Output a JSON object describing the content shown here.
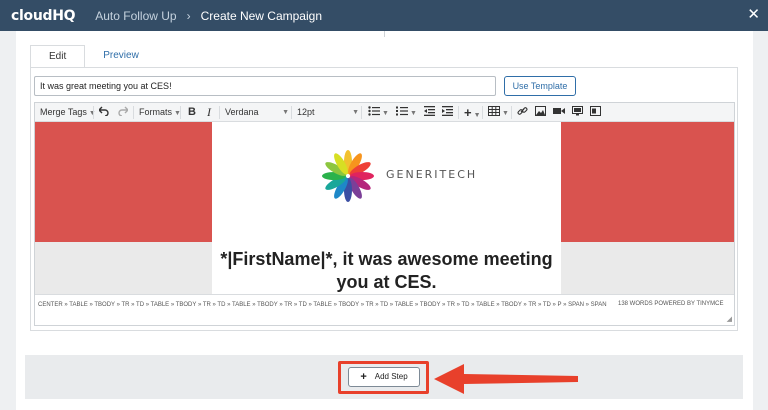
{
  "app": {
    "logo": "cloudHQ"
  },
  "breadcrumb": {
    "parent": "Auto Follow Up",
    "separator": "›",
    "current": "Create New Campaign"
  },
  "window": {
    "close_symbol": "✕"
  },
  "tabs": [
    {
      "label": "Edit",
      "active": true
    },
    {
      "label": "Preview",
      "active": false
    }
  ],
  "subject": {
    "value": "It was great meeting you at CES!"
  },
  "use_template_label": "Use Template",
  "toolbar": {
    "merge_tags": "Merge Tags",
    "formats": "Formats",
    "bold": "B",
    "italic": "I",
    "font_family": "Verdana",
    "font_size": "12pt"
  },
  "email": {
    "brand": "GENERITECH",
    "headline": "*|FirstName|*, it was awesome meeting you at CES."
  },
  "status": {
    "path": "CENTER » TABLE » TBODY » TR » TD » TABLE » TBODY » TR » TD » TABLE » TBODY » TR » TD » TABLE » TBODY » TR » TD » TABLE » TBODY » TR » TD » TABLE » TBODY » TR » TD » P » SPAN » SPAN",
    "words": "138 WORDS POWERED BY TINYMCE"
  },
  "add_step_label": "Add Step",
  "colors": {
    "topbar": "#344d66",
    "accent": "#2f6ea8",
    "banner_red": "#d9534f",
    "highlight": "#e8402b"
  }
}
